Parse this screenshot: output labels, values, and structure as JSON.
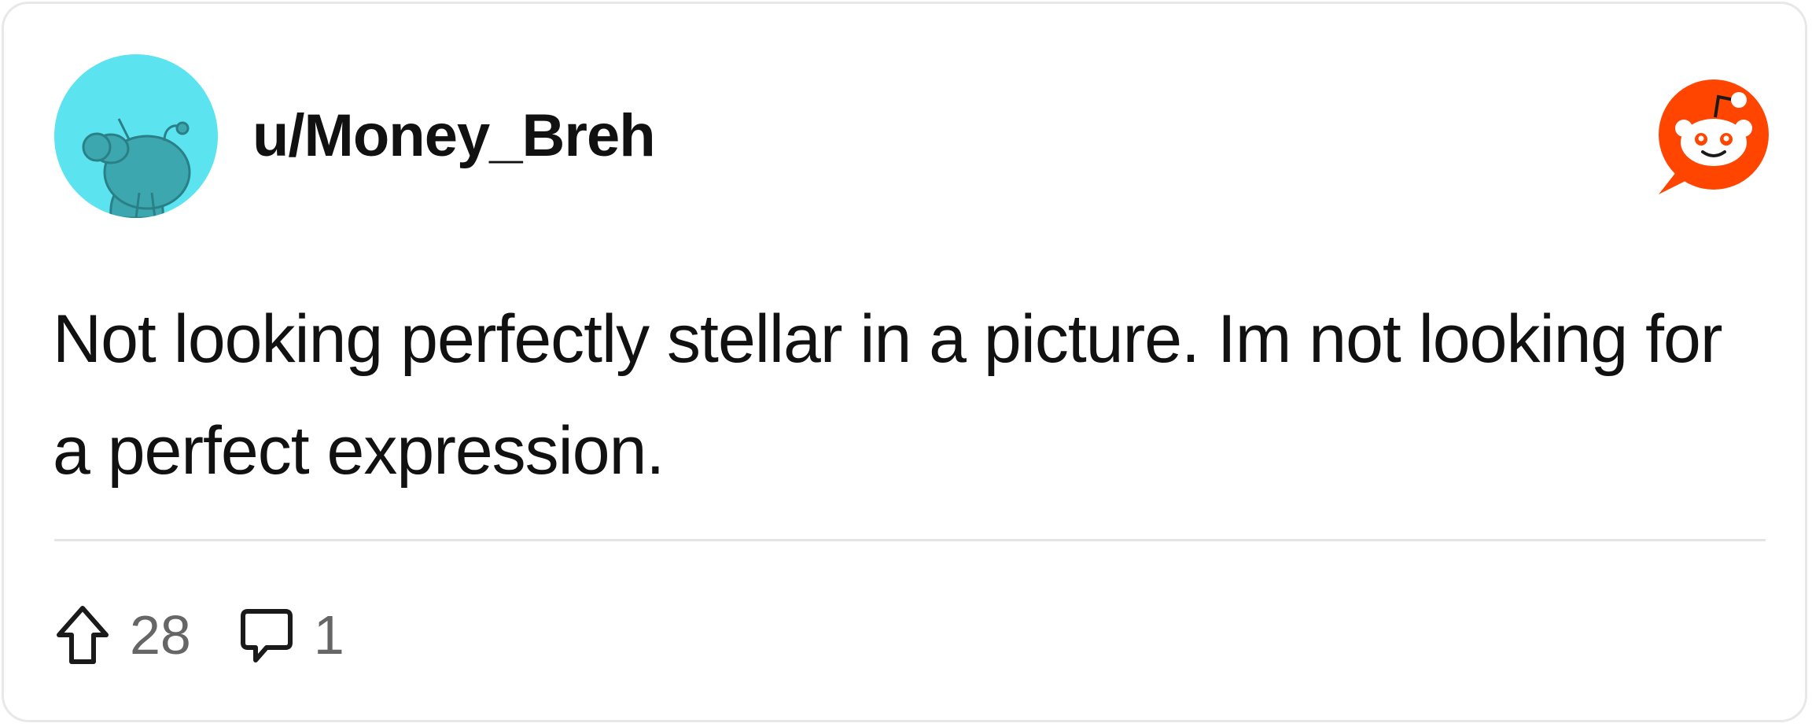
{
  "post": {
    "author": "u/Money_Breh",
    "avatar_icon": "snoo-avatar-icon",
    "brand_icon": "reddit-logo-icon",
    "text": "Not looking perfectly stellar in a picture. Im not looking for a perfect expression.",
    "upvotes": "28",
    "comments": "1"
  },
  "colors": {
    "avatar_bg": "#5BE3F0",
    "avatar_snoo": "#3DA7B0",
    "reddit_orange": "#FF4500",
    "count_text": "#666666",
    "divider": "#E4E4E4"
  }
}
